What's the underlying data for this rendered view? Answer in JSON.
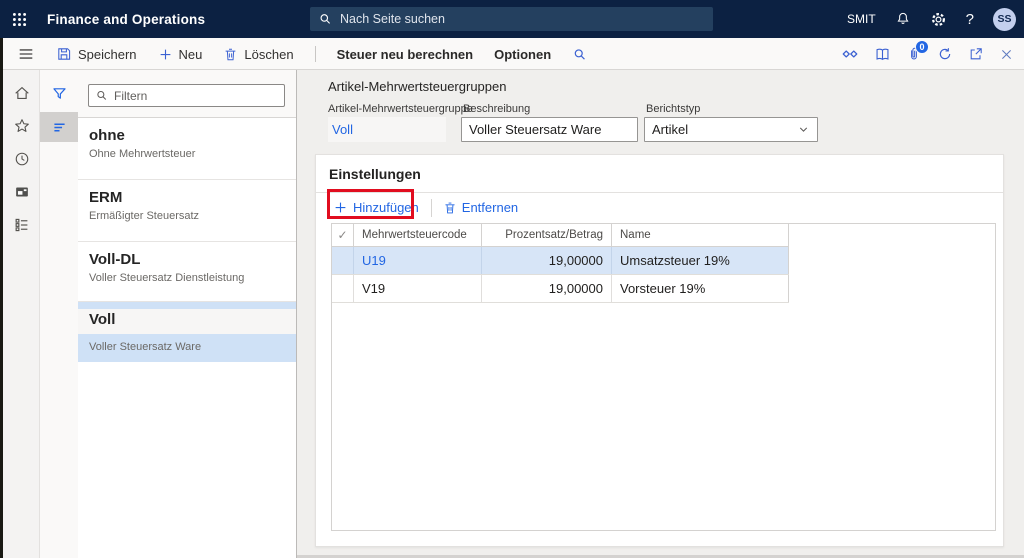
{
  "colors": {
    "accent": "#2266e3",
    "topbar": "#0c2142",
    "annotation_red": "#e10d1f",
    "selected_row": "#d7e5f7"
  },
  "topbar": {
    "app_title": "Finance and Operations",
    "search_placeholder": "Nach Seite suchen",
    "company": "SMIT",
    "help_label": "?",
    "avatar_initials": "SS"
  },
  "command_bar": {
    "save_label": "Speichern",
    "new_label": "Neu",
    "delete_label": "Löschen",
    "recalculate_label": "Steuer neu berechnen",
    "options_label": "Optionen",
    "attachments_badge": "0"
  },
  "nav": {
    "filter_placeholder": "Filtern",
    "items": [
      {
        "title": "ohne",
        "subtitle": "Ohne Mehrwertsteuer"
      },
      {
        "title": "ERM",
        "subtitle": "Ermäßigter Steuersatz"
      },
      {
        "title": "Voll-DL",
        "subtitle": "Voller Steuersatz Dienstleistung"
      },
      {
        "title": "Voll",
        "subtitle": "Voller Steuersatz Ware"
      }
    ]
  },
  "main": {
    "page_title": "Artikel-Mehrwertsteuergruppen",
    "fields": {
      "group_label": "Artikel-Mehrwertsteuergruppe",
      "group_value": "Voll",
      "description_label": "Beschreibung",
      "description_value": "Voller Steuersatz Ware",
      "report_type_label": "Berichtstyp",
      "report_type_value": "Artikel"
    },
    "settings": {
      "title": "Einstellungen",
      "add_label": "Hinzufügen",
      "remove_label": "Entfernen",
      "grid": {
        "select_all_glyph": "✓",
        "columns": {
          "code": "Mehrwertsteuercode",
          "rate": "Prozentsatz/Betrag",
          "name": "Name"
        },
        "rows": [
          {
            "code": "U19",
            "rate": "19,00000",
            "name": "Umsatzsteuer 19%"
          },
          {
            "code": "V19",
            "rate": "19,00000",
            "name": "Vorsteuer 19%"
          }
        ]
      }
    }
  }
}
